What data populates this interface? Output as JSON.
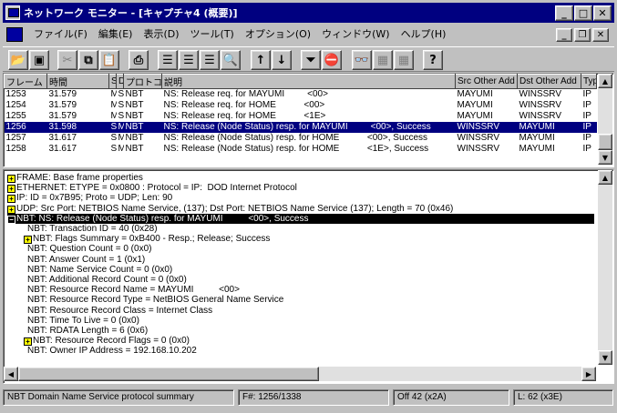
{
  "window": {
    "title": "ネットワーク モニター - [キャプチャ4 (概要)]"
  },
  "menu": [
    "ファイル(F)",
    "編集(E)",
    "表示(D)",
    "ツール(T)",
    "オプション(O)",
    "ウィンドウ(W)",
    "ヘルプ(H)"
  ],
  "toolbar": {
    "icons": [
      "open-icon",
      "save-icon",
      "cut-icon",
      "copy-icon",
      "paste-icon",
      "print-icon",
      "pane-summary-icon",
      "pane-detail-icon",
      "pane-hex-icon",
      "find-icon",
      "prev-arrow-icon",
      "next-arrow-icon",
      "filter-icon",
      "disable-filter-icon",
      "find-frame-icon",
      "find-prev-icon",
      "find-next-icon",
      "help-icon"
    ],
    "help_label": "?"
  },
  "summary": {
    "columns": [
      "フレーム",
      "時間",
      "S",
      "D",
      "プロトコル",
      "説明",
      "Src Other Add",
      "Dst Other Add",
      "Typ"
    ],
    "rows": [
      [
        "1253",
        "31.579",
        "M",
        "S",
        "NBT",
        "NS: Release req. for MAYUMI         <00>",
        "MAYUMI",
        "WINSSRV",
        "IP"
      ],
      [
        "1254",
        "31.579",
        "M",
        "S",
        "NBT",
        "NS: Release req. for HOME           <00>",
        "MAYUMI",
        "WINSSRV",
        "IP"
      ],
      [
        "1255",
        "31.579",
        "M",
        "S",
        "NBT",
        "NS: Release req. for HOME           <1E>",
        "MAYUMI",
        "WINSSRV",
        "IP"
      ],
      [
        "1256",
        "31.598",
        "S",
        "M",
        "NBT",
        "NS: Release (Node Status) resp. for MAYUMI         <00>, Success",
        "WINSSRV",
        "MAYUMI",
        "IP"
      ],
      [
        "1257",
        "31.617",
        "S",
        "M",
        "NBT",
        "NS: Release (Node Status) resp. for HOME           <00>, Success",
        "WINSSRV",
        "MAYUMI",
        "IP"
      ],
      [
        "1258",
        "31.617",
        "S",
        "M",
        "NBT",
        "NS: Release (Node Status) resp. for HOME           <1E>, Success",
        "WINSSRV",
        "MAYUMI",
        "IP"
      ]
    ],
    "selected_row": 3
  },
  "detail": {
    "lines": [
      {
        "exp": "+",
        "indent": 0,
        "text": "FRAME: Base frame properties"
      },
      {
        "exp": "+",
        "indent": 0,
        "text": "ETHERNET: ETYPE = 0x0800 : Protocol = IP:  DOD Internet Protocol"
      },
      {
        "exp": "+",
        "indent": 0,
        "text": "IP: ID = 0x7B95; Proto = UDP; Len: 90"
      },
      {
        "exp": "+",
        "indent": 0,
        "text": "UDP: Src Port: NETBIOS Name Service, (137); Dst Port: NETBIOS Name Service (137); Length = 70 (0x46)"
      },
      {
        "exp": "−",
        "indent": 0,
        "text": "NBT: NS: Release (Node Status) resp. for MAYUMI          <00>, Success",
        "sel": true
      },
      {
        "exp": "",
        "indent": 1,
        "text": "NBT: Transaction ID = 40 (0x28)"
      },
      {
        "exp": "+",
        "indent": 1,
        "text": "NBT: Flags Summary = 0xB400 - Resp.; Release; Success"
      },
      {
        "exp": "",
        "indent": 1,
        "text": "NBT: Question Count = 0 (0x0)"
      },
      {
        "exp": "",
        "indent": 1,
        "text": "NBT: Answer Count = 1 (0x1)"
      },
      {
        "exp": "",
        "indent": 1,
        "text": "NBT: Name Service Count = 0 (0x0)"
      },
      {
        "exp": "",
        "indent": 1,
        "text": "NBT: Additional Record Count = 0 (0x0)"
      },
      {
        "exp": "",
        "indent": 1,
        "text": "NBT: Resource Record Name = MAYUMI          <00>"
      },
      {
        "exp": "",
        "indent": 1,
        "text": "NBT: Resource Record Type = NetBIOS General Name Service"
      },
      {
        "exp": "",
        "indent": 1,
        "text": "NBT: Resource Record Class = Internet Class"
      },
      {
        "exp": "",
        "indent": 1,
        "text": "NBT: Time To Live = 0 (0x0)"
      },
      {
        "exp": "",
        "indent": 1,
        "text": "NBT: RDATA Length = 6 (0x6)"
      },
      {
        "exp": "+",
        "indent": 1,
        "text": "NBT: Resource Record Flags = 0 (0x0)"
      },
      {
        "exp": "",
        "indent": 1,
        "text": "NBT: Owner IP Address = 192.168.10.202"
      }
    ]
  },
  "status": {
    "description": "NBT Domain Name Service protocol summary",
    "frame": "F#: 1256/1338",
    "offset": "Off 42 (x2A)",
    "length": "L: 62 (x3E)"
  }
}
